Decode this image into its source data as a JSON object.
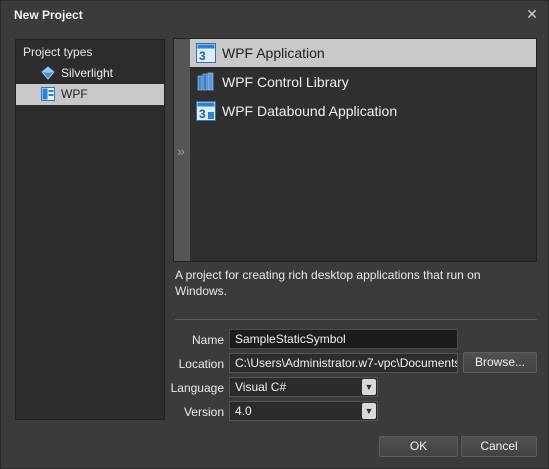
{
  "dialog": {
    "title": "New Project",
    "close_glyph": "✕"
  },
  "project_types": {
    "header": "Project types",
    "items": [
      {
        "label": "Silverlight",
        "icon": "silverlight-icon",
        "selected": false
      },
      {
        "label": "WPF",
        "icon": "wpf-icon",
        "selected": true
      }
    ]
  },
  "templates": {
    "expander_glyph": "»",
    "items": [
      {
        "label": "WPF Application",
        "icon": "wpf-application-icon",
        "selected": true
      },
      {
        "label": "WPF Control Library",
        "icon": "wpf-control-library-icon",
        "selected": false
      },
      {
        "label": "WPF Databound Application",
        "icon": "wpf-databound-application-icon",
        "selected": false
      }
    ]
  },
  "description": "A project for creating rich desktop applications that run on Windows.",
  "form": {
    "name_label": "Name",
    "name_value": "SampleStaticSymbol",
    "location_label": "Location",
    "location_value": "C:\\Users\\Administrator.w7-vpc\\Documents\\",
    "browse_label": "Browse...",
    "language_label": "Language",
    "language_value": "Visual C#",
    "version_label": "Version",
    "version_value": "4.0"
  },
  "buttons": {
    "ok": "OK",
    "cancel": "Cancel"
  },
  "colors": {
    "background": "#3b3b3b",
    "panel": "#2c2c2c",
    "selection": "#c9c9c9",
    "accent_blue": "#2f7fd6"
  }
}
